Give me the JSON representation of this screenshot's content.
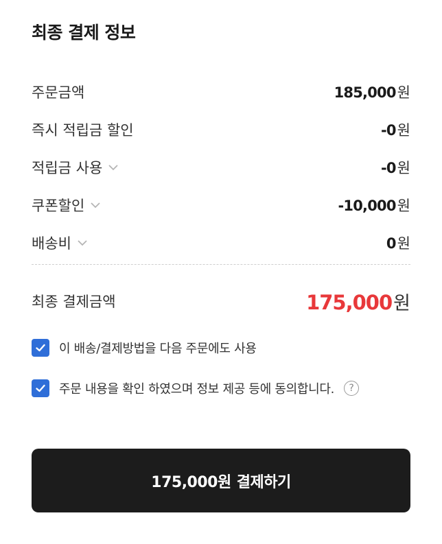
{
  "title": "최종 결제 정보",
  "rows": [
    {
      "label": "주문금액",
      "value": "185,000",
      "has_chevron": false
    },
    {
      "label": "즉시 적립금 할인",
      "value": "-0",
      "has_chevron": false
    },
    {
      "label": "적립금 사용",
      "value": "-0",
      "has_chevron": true
    },
    {
      "label": "쿠폰할인",
      "value": "-10,000",
      "has_chevron": true
    },
    {
      "label": "배송비",
      "value": "0",
      "has_chevron": true
    }
  ],
  "currency": "원",
  "final": {
    "label": "최종 결제금액",
    "value": "175,000",
    "currency": "원"
  },
  "checkboxes": [
    {
      "label": "이 배송/결제방법을 다음 주문에도 사용",
      "checked": true
    },
    {
      "label": "주문 내용을 확인 하였으며 정보 제공 등에 동의합니다.",
      "checked": true
    }
  ],
  "help_icon": "?",
  "pay_button": {
    "amount": "175,000원",
    "label": "결제하기"
  },
  "colors": {
    "accent": "#e8383a",
    "checkbox": "#2f6ed8",
    "button_bg": "#1c1c1c"
  },
  "icons": [
    "chevron-down-icon",
    "checkmark-icon",
    "help-icon"
  ]
}
